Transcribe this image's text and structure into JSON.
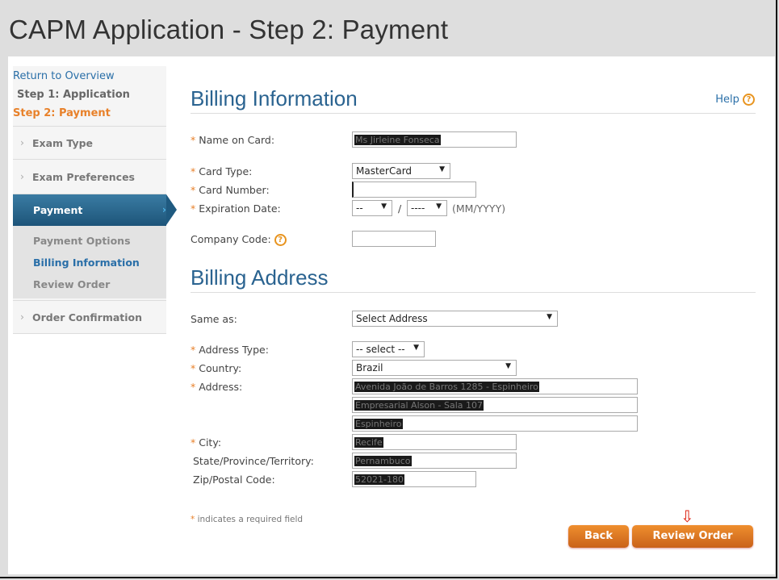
{
  "page_title": "CAPM Application - Step 2: Payment",
  "sidebar": {
    "return_link": "Return to Overview",
    "step1": "Step 1: Application",
    "step2": "Step 2: Payment",
    "items": [
      {
        "label": "Exam Type"
      },
      {
        "label": "Exam Preferences"
      },
      {
        "label": "Payment"
      },
      {
        "label": "Order Confirmation"
      }
    ],
    "sub_items": [
      {
        "label": "Payment Options"
      },
      {
        "label": "Billing Information"
      },
      {
        "label": "Review Order"
      }
    ]
  },
  "billing_info": {
    "heading": "Billing Information",
    "help": "Help",
    "name_label": "Name on Card:",
    "name_value": "Ms Jirleine Fonseca",
    "card_type_label": "Card Type:",
    "card_type_value": "MasterCard",
    "card_number_label": "Card Number:",
    "card_number_value": "",
    "expiration_label": "Expiration Date:",
    "exp_month": "--",
    "exp_sep": "/",
    "exp_year": "----",
    "exp_format": "(MM/YYYY)",
    "company_code_label": "Company Code:",
    "company_code_value": ""
  },
  "billing_address": {
    "heading": "Billing Address",
    "same_as_label": "Same as:",
    "same_as_value": "Select Address",
    "address_type_label": "Address Type:",
    "address_type_value": "-- select --",
    "country_label": "Country:",
    "country_value": "Brazil",
    "address_label": "Address:",
    "address_lines": [
      "Avenida João de Barros 1285 - Espinheiro",
      "Empresarial Alson - Sala 107",
      "Espinheiro"
    ],
    "city_label": "City:",
    "city_value": "Recife",
    "state_label": "State/Province/Territory:",
    "state_value": "Pernambuco",
    "zip_label": "Zip/Postal Code:",
    "zip_value": "52021-180"
  },
  "required_mark": "*",
  "required_note": "indicates a required field",
  "buttons": {
    "back": "Back",
    "review": "Review Order"
  },
  "colors": {
    "accent": "#e8812a",
    "link": "#2a6fa8",
    "nav_active": "#1d5479"
  }
}
